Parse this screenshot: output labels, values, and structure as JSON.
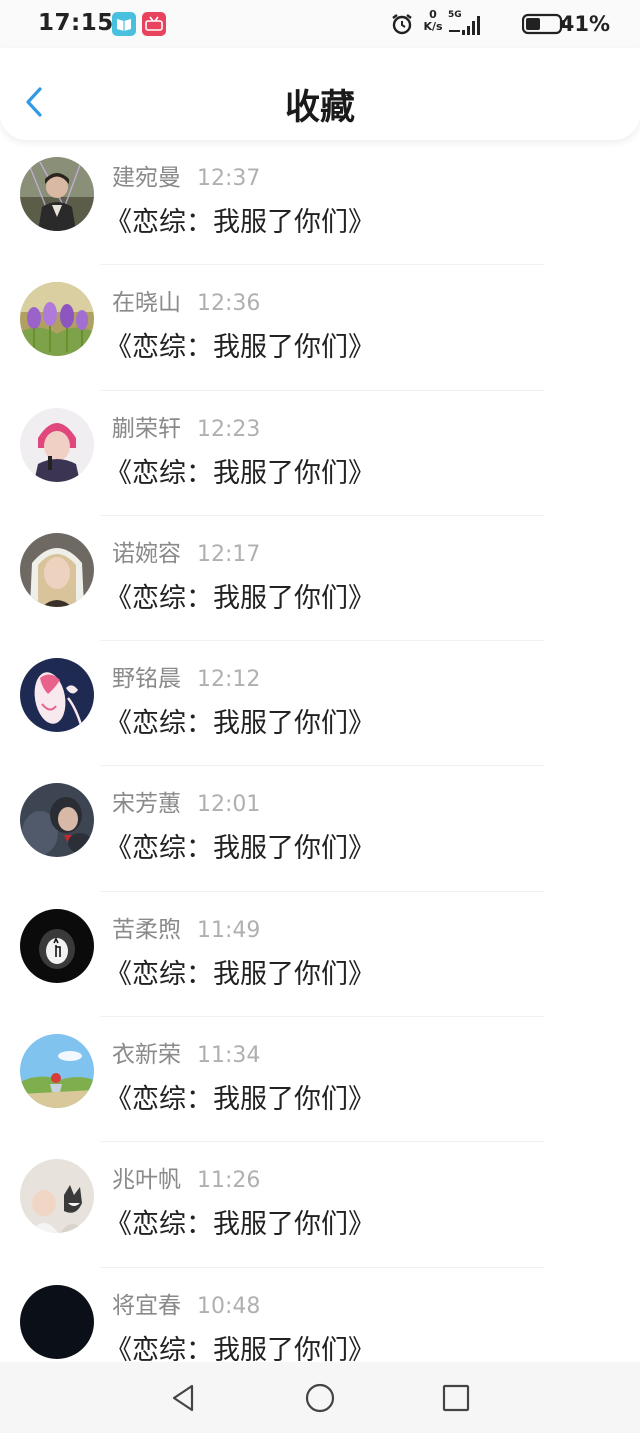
{
  "status": {
    "time": "17:15",
    "net_speed_value": "0",
    "net_speed_unit": "K/s",
    "network": "5G",
    "battery": "41%",
    "icons": [
      "reader-app-icon",
      "video-app-icon",
      "alarm-icon",
      "signal-icon",
      "battery-icon"
    ]
  },
  "header": {
    "title": "收藏",
    "back_icon": "chevron-left-icon",
    "accent_color": "#2f9be6"
  },
  "items": [
    {
      "name": "建宛曼",
      "time": "12:37",
      "text": "《恋综：我服了你们》"
    },
    {
      "name": "在晓山",
      "time": "12:36",
      "text": "《恋综：我服了你们》"
    },
    {
      "name": "蒯荣轩",
      "time": "12:23",
      "text": "《恋综：我服了你们》"
    },
    {
      "name": "诺婉容",
      "time": "12:17",
      "text": "《恋综：我服了你们》"
    },
    {
      "name": "野铭晨",
      "time": "12:12",
      "text": "《恋综：我服了你们》"
    },
    {
      "name": "宋芳蕙",
      "time": "12:01",
      "text": "《恋综：我服了你们》"
    },
    {
      "name": "苦柔煦",
      "time": "11:49",
      "text": "《恋综：我服了你们》"
    },
    {
      "name": "衣新荣",
      "time": "11:34",
      "text": "《恋综：我服了你们》"
    },
    {
      "name": "兆叶帆",
      "time": "11:26",
      "text": "《恋综：我服了你们》"
    },
    {
      "name": "将宜春",
      "time": "10:48",
      "text": "《恋综：我服了你们》"
    }
  ],
  "nav": {
    "buttons": [
      "nav-back-triangle-icon",
      "nav-home-circle-icon",
      "nav-recent-square-icon"
    ]
  }
}
